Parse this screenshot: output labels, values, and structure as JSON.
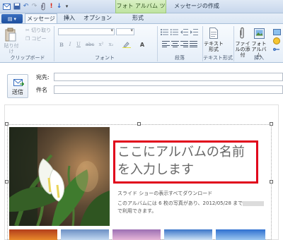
{
  "titlebar": {
    "context_tab": "フォト アルバム ツール",
    "window_title": "メッセージの作成"
  },
  "tabs": [
    {
      "label": "メッセージ",
      "active": true
    },
    {
      "label": "挿入",
      "active": false
    },
    {
      "label": "オプション",
      "active": false
    },
    {
      "label": "形式",
      "active": false
    }
  ],
  "ribbon": {
    "clipboard": {
      "paste": "貼り付け",
      "cut": "切り取り",
      "copy": "コピー",
      "group_label": "クリップボード"
    },
    "font": {
      "group_label": "フォント",
      "bold": "B",
      "italic": "I",
      "underline": "U",
      "strike": "abc"
    },
    "paragraph": {
      "group_label": "段落"
    },
    "text_format": {
      "button": "テキスト形式",
      "group_label": "テキスト形式"
    },
    "insert": {
      "attach_file": "ファイルの添付",
      "photo_album": "フォト アルバム",
      "group_label": "挿入"
    }
  },
  "message": {
    "send_label": "送信",
    "to_label": "宛先:",
    "subject_label": "件名",
    "to_value": "",
    "subject_value": ""
  },
  "album": {
    "title": "ここにアルバムの名前を入力します",
    "slideshow_link": "スライド ショーの表示",
    "download_all_link": "すべてダウンロード",
    "description_line1": "このアルバムには 6 枚の写真があり、2012/05/28 まで",
    "description_line2": "で利用できます。"
  },
  "colors": {
    "highlight_border": "#e0001b",
    "context_tab": "#bfe3a1",
    "ribbon_bg": "#e5eef8"
  }
}
